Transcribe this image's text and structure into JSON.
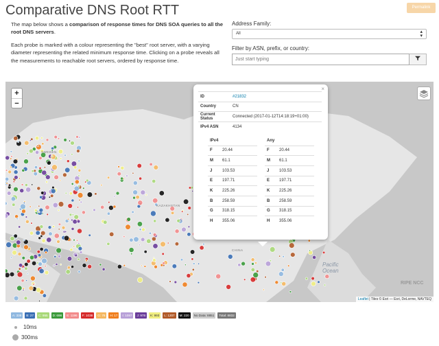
{
  "header": {
    "title": "Comparative DNS Root RTT",
    "permalink_label": "Permalink"
  },
  "intro": {
    "p1_before": "The map below shows a ",
    "p1_bold": "comparison of response times for DNS SOA queries to all the root DNS servers",
    "p1_after": ".",
    "p2": "Each probe is marked with a colour representing the \"best\" root server, with a varying diameter representing the related minimum response time. Clicking on a probe reveals all the measurements to reachable root servers, ordered by response time."
  },
  "form": {
    "address_family_label": "Address Family:",
    "address_family_value": "All",
    "filter_label": "Filter by ASN, prefix, or country:",
    "filter_placeholder": "Just start typing",
    "filter_button_icon": "filter-icon"
  },
  "map": {
    "zoom_in": "+",
    "zoom_out": "−",
    "layers_icon": "layers-icon",
    "labels": {
      "sweden": "SWEDEN",
      "kazakhstan": "KAZAKHSTAN",
      "china": "CHINA",
      "pacific": "Pacific",
      "ocean": "Ocean",
      "ripe": "RIPE NCC"
    },
    "attribution_link": "Leaflet",
    "attribution_text": " | Tiles © Esri — Esri, DeLorme, NAVTEQ"
  },
  "popup": {
    "close": "×",
    "info": [
      {
        "key": "ID",
        "value": "#21832",
        "link": true
      },
      {
        "key": "Country",
        "value": "CN"
      },
      {
        "key": "Current Status",
        "value": "Connected (2017-01-12T14:18:19+01:00)"
      },
      {
        "key": "IPv4 ASN",
        "value": "4134"
      }
    ],
    "ipv4_header": "IPv4",
    "any_header": "Any",
    "ipv4": [
      {
        "k": "F",
        "v": "20.44"
      },
      {
        "k": "M",
        "v": "61.1"
      },
      {
        "k": "J",
        "v": "103.53"
      },
      {
        "k": "E",
        "v": "197.71"
      },
      {
        "k": "K",
        "v": "225.26"
      },
      {
        "k": "B",
        "v": "258.59"
      },
      {
        "k": "G",
        "v": "318.15"
      },
      {
        "k": "H",
        "v": "355.06"
      }
    ],
    "any": [
      {
        "k": "F",
        "v": "20.44"
      },
      {
        "k": "M",
        "v": "61.1"
      },
      {
        "k": "J",
        "v": "103.53"
      },
      {
        "k": "E",
        "v": "197.71"
      },
      {
        "k": "K",
        "v": "225.26"
      },
      {
        "k": "B",
        "v": "258.59"
      },
      {
        "k": "G",
        "v": "318.15"
      },
      {
        "k": "H",
        "v": "355.06"
      }
    ]
  },
  "legend": [
    {
      "label": "A: 338",
      "color": "#8fb8e0"
    },
    {
      "label": "B: 27",
      "color": "#3a6fb5"
    },
    {
      "label": "C: 955",
      "color": "#a8d878"
    },
    {
      "label": "D: 698",
      "color": "#3a9a3a"
    },
    {
      "label": "E: 1196",
      "color": "#f28b8b"
    },
    {
      "label": "F: 1038",
      "color": "#d62a2a"
    },
    {
      "label": "G: 76",
      "color": "#f5b860"
    },
    {
      "label": "H: 17",
      "color": "#f07f1e"
    },
    {
      "label": "I: 1087",
      "color": "#b8a0d8"
    },
    {
      "label": "J: 978",
      "color": "#6a3d9a"
    },
    {
      "label": "K: 993",
      "color": "#f0ee80"
    },
    {
      "label": "L: 1207",
      "color": "#b15a28"
    },
    {
      "label": "M: 220",
      "color": "#111111"
    },
    {
      "label": "No Data: 8851",
      "color": "#cccccc"
    },
    {
      "label": "Total: 8832",
      "color": "#777777"
    }
  ],
  "size_legend": [
    {
      "label": "10ms"
    },
    {
      "label": "300ms"
    }
  ]
}
